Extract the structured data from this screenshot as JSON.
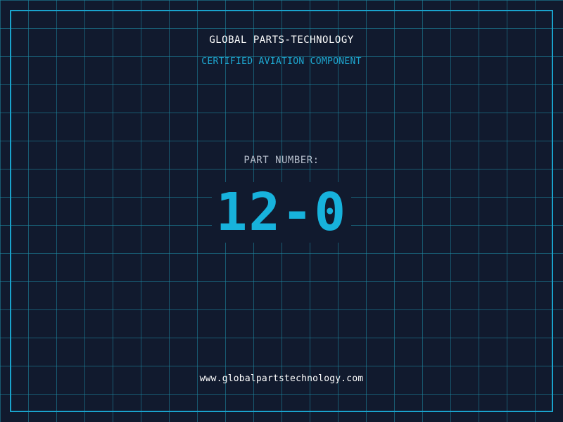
{
  "header": {
    "company": "GLOBAL PARTS-TECHNOLOGY",
    "tagline": "CERTIFIED AVIATION COMPONENT"
  },
  "part": {
    "label": "PART NUMBER:",
    "number": "12-0"
  },
  "footer": {
    "website": "www.globalpartstechnology.com"
  },
  "colors": {
    "background": "#111a2e",
    "grid": "#1e8ca5",
    "frame": "#1aa3cc",
    "accent": "#17b2dc",
    "text": "#ffffff",
    "muted": "#b7bfcc"
  }
}
